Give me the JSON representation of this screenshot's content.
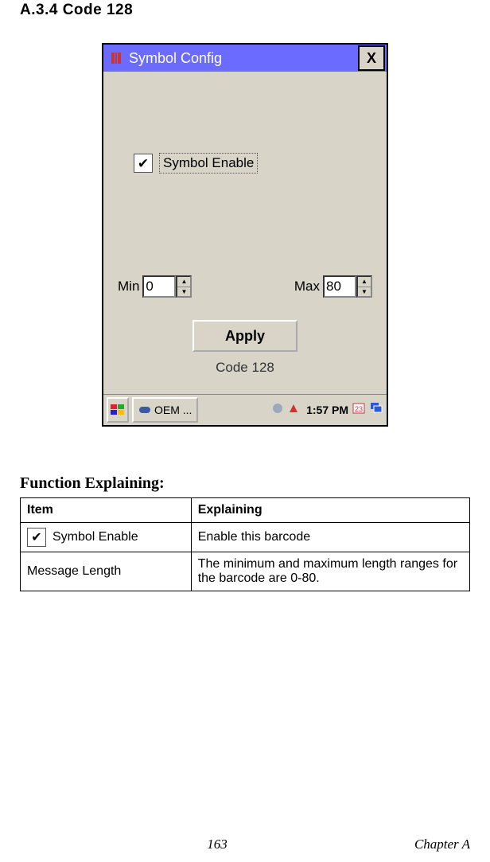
{
  "section_heading": "A.3.4    Code 128",
  "window": {
    "title": "Symbol Config",
    "close": "X",
    "symbol_enable_label": "Symbol Enable",
    "checked": true,
    "min_label": "Min",
    "min_value": "0",
    "max_label": "Max",
    "max_value": "80",
    "apply_label": "Apply",
    "code_label": "Code 128",
    "taskbar": {
      "oem_label": "OEM ...",
      "time": "1:57 PM"
    }
  },
  "function_heading": "Function Explaining:",
  "table": {
    "headers": {
      "item": "Item",
      "explaining": "Explaining"
    },
    "rows": [
      {
        "item": "Symbol Enable",
        "explaining": "Enable this barcode"
      },
      {
        "item": "Message Length",
        "explaining": "The minimum and maximum length ranges for the barcode are 0-80."
      }
    ]
  },
  "footer": {
    "page": "163",
    "chapter": "Chapter A"
  }
}
